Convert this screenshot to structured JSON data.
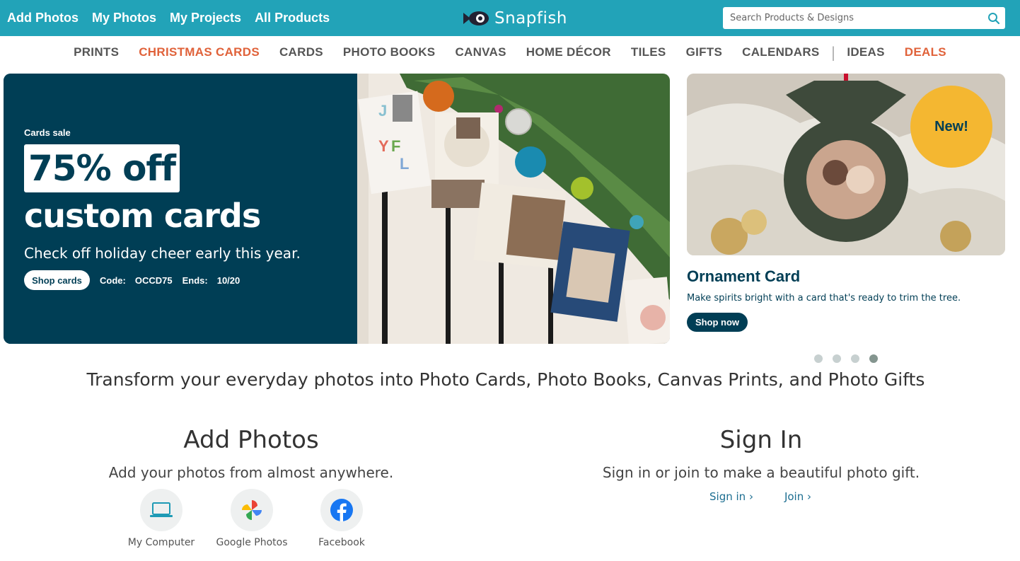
{
  "topnav": {
    "items": [
      "Add Photos",
      "My Photos",
      "My Projects",
      "All Products"
    ],
    "brand": "Snapfish",
    "search_placeholder": "Search Products & Designs"
  },
  "categories": {
    "items": [
      "PRINTS",
      "CHRISTMAS CARDS",
      "CARDS",
      "PHOTO BOOKS",
      "CANVAS",
      "HOME DÉCOR",
      "TILES",
      "GIFTS",
      "CALENDARS",
      "IDEAS",
      "DEALS"
    ],
    "separator": "|"
  },
  "hero": {
    "kicker": "Cards sale",
    "headline_box": "75% off",
    "headline_line": "custom cards",
    "subline": "Check off holiday cheer early this year.",
    "button": "Shop cards",
    "code_label": "Code:",
    "code_value": "OCCD75",
    "ends_label": "Ends:",
    "ends_value": "10/20"
  },
  "side_promo": {
    "badge": "New!",
    "title": "Ornament Card",
    "description": "Make spirits bright with a card that's ready to trim the tree.",
    "button": "Shop now"
  },
  "carousel": {
    "count": 4,
    "active_index": 3
  },
  "tagline": "Transform your everyday photos into Photo Cards, Photo Books, Canvas Prints, and Photo Gifts",
  "add_photos": {
    "title": "Add Photos",
    "description": "Add your photos from almost anywhere.",
    "sources": [
      {
        "label": "My Computer",
        "icon": "laptop-icon"
      },
      {
        "label": "Google Photos",
        "icon": "google-photos-icon"
      },
      {
        "label": "Facebook",
        "icon": "facebook-icon"
      }
    ]
  },
  "sign_in": {
    "title": "Sign In",
    "description": "Sign in or join to make a beautiful photo gift.",
    "signin_link": "Sign in",
    "join_link": "Join",
    "chevron": "›"
  },
  "colors": {
    "topbar": "#22a3b8",
    "navy": "#003e55",
    "accent_orange": "#e0623a",
    "badge_yellow": "#f4b731"
  }
}
